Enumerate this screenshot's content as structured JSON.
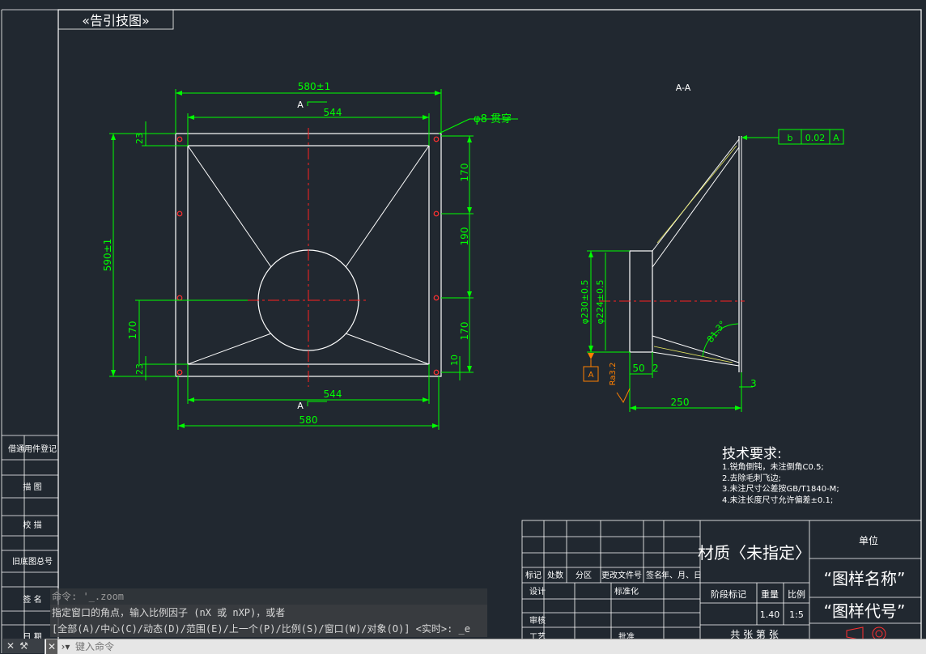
{
  "drawing": {
    "title_stamp": "«告引技图»",
    "view_label": "A-A",
    "dims": {
      "top_width": "580±1",
      "inner_width": "544",
      "bottom_inner": "544",
      "bottom_width": "580",
      "left_height": "590±1",
      "left_23": "23",
      "left_170": "170",
      "left_23b": "23",
      "right_170a": "170",
      "right_190": "190",
      "right_170b": "170",
      "right_10": "10",
      "hole_note": "φ8 贯穿",
      "section_marker": "A",
      "dia_outer": "φ230±0.5",
      "dia_inner": "φ224±0.5",
      "dim_50": "50",
      "dim_2": "2",
      "dim_250": "250",
      "dim_3": "3",
      "angle": "81.3°",
      "datum": "A",
      "roughness": "Ra3.2",
      "tol_sym": "b",
      "tol_val": "0.02",
      "tol_ref": "A"
    },
    "tech": {
      "title": "技术要求:",
      "items": [
        "1.锐角倒钝，未注倒角C0.5;",
        "2.去除毛刺飞边;",
        "3.未注尺寸公差按GB/T1840-M;",
        "4.未注长度尺寸允许偏差±0.1;"
      ]
    },
    "title_block": {
      "material": "材质〈未指定〉",
      "company": "单位",
      "drawing_name": "“图样名称”",
      "drawing_code": "“图样代号”",
      "headers": [
        "标记",
        "处数",
        "分区",
        "更改文件号",
        "签名",
        "年、月、日"
      ],
      "design": "设计",
      "standardize": "标准化",
      "review": "审核",
      "process": "工艺",
      "approve": "批准",
      "stage_mark": "阶段标记",
      "weight": "重量",
      "scale": "比例",
      "weight_val": "1.40",
      "scale_val": "1:5",
      "sheets": "共 张 第 张"
    },
    "left_strip": [
      "借通用件登记",
      "描 图",
      "校 描",
      "旧底图总号",
      "签 名",
      "日 期"
    ]
  },
  "command": {
    "history": [
      "命令: '_.zoom",
      "指定窗口的角点，输入比例因子 (nX 或 nXP)，或者",
      "[全部(A)/中心(C)/动态(D)/范围(E)/上一个(P)/比例(S)/窗口(W)/对象(O)] <实时>: _e"
    ],
    "placeholder": "键入命令"
  },
  "colors": {
    "background": "#212830",
    "geometry": "#ffffff",
    "dimension": "#00ff00",
    "centerline": "#ff2020",
    "datum": "#ff8000",
    "hole": "#ff3030"
  }
}
